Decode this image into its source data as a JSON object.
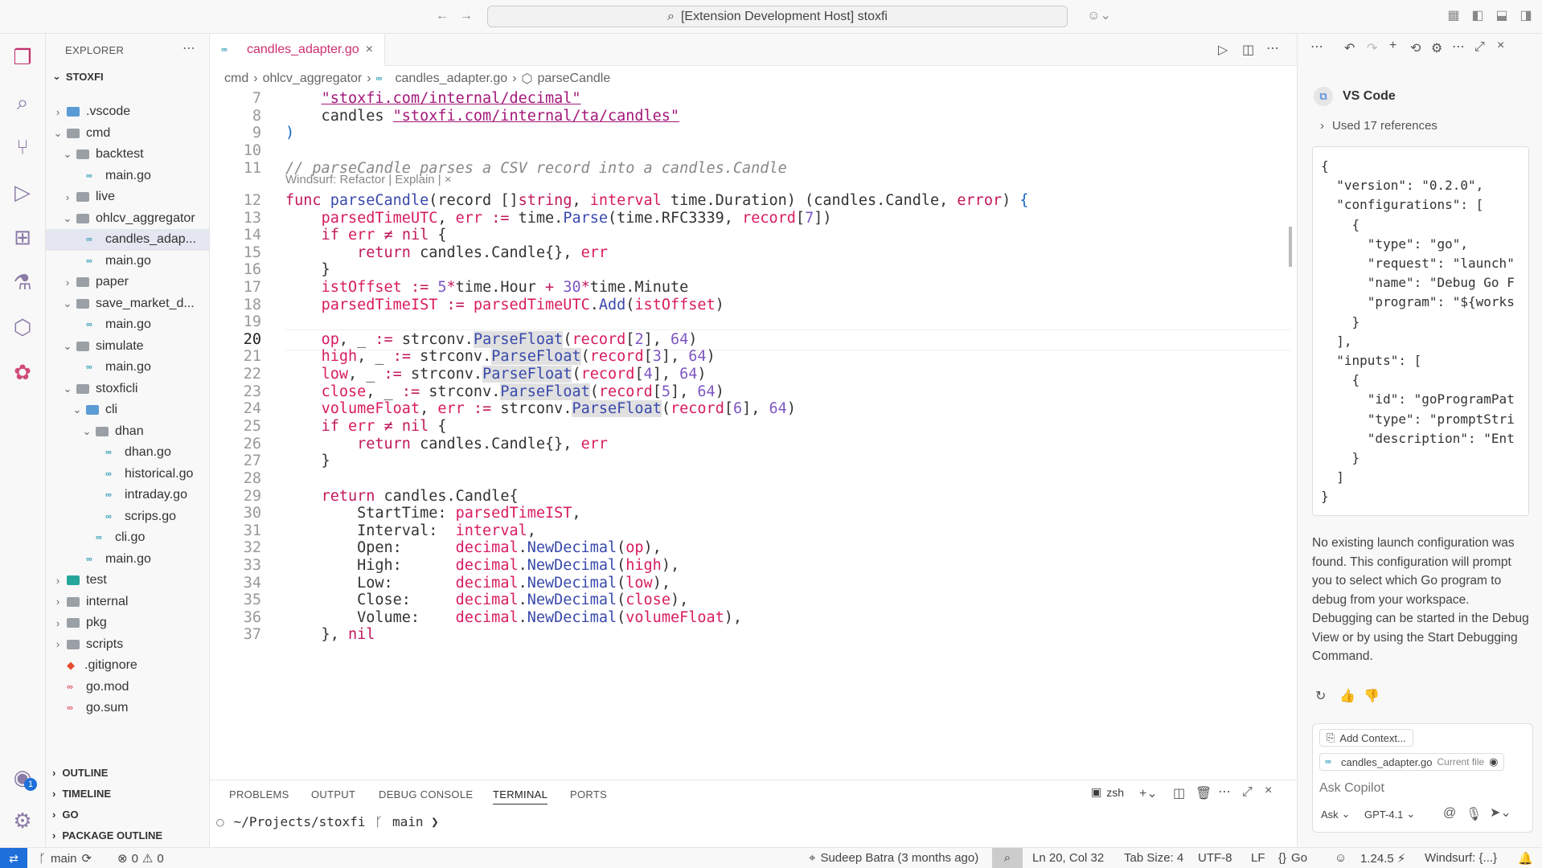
{
  "titlebar": {
    "title": "[Extension Development Host] stoxfi"
  },
  "sidebar": {
    "header": "EXPLORER",
    "root": "STOXFI",
    "items": [
      {
        "label": ".vscode",
        "depth": 1,
        "kind": "folder-blue",
        "chev": "›"
      },
      {
        "label": "cmd",
        "depth": 1,
        "kind": "folder",
        "chev": "⌄"
      },
      {
        "label": "backtest",
        "depth": 2,
        "kind": "folder",
        "chev": "⌄"
      },
      {
        "label": "main.go",
        "depth": 3,
        "kind": "go",
        "chev": ""
      },
      {
        "label": "live",
        "depth": 2,
        "kind": "folder",
        "chev": "›"
      },
      {
        "label": "ohlcv_aggregator",
        "depth": 2,
        "kind": "folder",
        "chev": "⌄"
      },
      {
        "label": "candles_adap...",
        "depth": 3,
        "kind": "go",
        "chev": "",
        "selected": true
      },
      {
        "label": "main.go",
        "depth": 3,
        "kind": "go",
        "chev": ""
      },
      {
        "label": "paper",
        "depth": 2,
        "kind": "folder",
        "chev": "›"
      },
      {
        "label": "save_market_d...",
        "depth": 2,
        "kind": "folder",
        "chev": "⌄"
      },
      {
        "label": "main.go",
        "depth": 3,
        "kind": "go",
        "chev": ""
      },
      {
        "label": "simulate",
        "depth": 2,
        "kind": "folder",
        "chev": "⌄"
      },
      {
        "label": "main.go",
        "depth": 3,
        "kind": "go",
        "chev": ""
      },
      {
        "label": "stoxficli",
        "depth": 2,
        "kind": "folder",
        "chev": "⌄"
      },
      {
        "label": "cli",
        "depth": 3,
        "kind": "folder-blue",
        "chev": "⌄"
      },
      {
        "label": "dhan",
        "depth": 4,
        "kind": "folder",
        "chev": "⌄"
      },
      {
        "label": "dhan.go",
        "depth": 5,
        "kind": "go",
        "chev": ""
      },
      {
        "label": "historical.go",
        "depth": 5,
        "kind": "go",
        "chev": ""
      },
      {
        "label": "intraday.go",
        "depth": 5,
        "kind": "go",
        "chev": ""
      },
      {
        "label": "scrips.go",
        "depth": 5,
        "kind": "go",
        "chev": ""
      },
      {
        "label": "cli.go",
        "depth": 4,
        "kind": "go",
        "chev": ""
      },
      {
        "label": "main.go",
        "depth": 3,
        "kind": "go",
        "chev": ""
      },
      {
        "label": "test",
        "depth": 1,
        "kind": "folder-teal",
        "chev": "›"
      },
      {
        "label": "internal",
        "depth": 1,
        "kind": "folder",
        "chev": "›"
      },
      {
        "label": "pkg",
        "depth": 1,
        "kind": "folder",
        "chev": "›"
      },
      {
        "label": "scripts",
        "depth": 1,
        "kind": "folder",
        "chev": "›"
      },
      {
        "label": ".gitignore",
        "depth": 1,
        "kind": "git",
        "chev": ""
      },
      {
        "label": "go.mod",
        "depth": 1,
        "kind": "mod",
        "chev": ""
      },
      {
        "label": "go.sum",
        "depth": 1,
        "kind": "mod",
        "chev": ""
      }
    ],
    "sections": [
      "OUTLINE",
      "TIMELINE",
      "GO",
      "PACKAGE OUTLINE"
    ]
  },
  "editor": {
    "tab_label": "candles_adapter.go",
    "breadcrumbs": [
      "cmd",
      "ohlcv_aggregator",
      "candles_adapter.go",
      "parseCandle"
    ],
    "codelens": "Windsurf: Refactor | Explain | ×",
    "line_numbers": [
      "7",
      "8",
      "9",
      "10",
      "11",
      "12",
      "13",
      "14",
      "15",
      "16",
      "17",
      "18",
      "19",
      "20",
      "21",
      "22",
      "23",
      "24",
      "25",
      "26",
      "27",
      "28",
      "29",
      "30",
      "31",
      "32",
      "33",
      "34",
      "35",
      "36",
      "37"
    ]
  },
  "panel": {
    "tabs": [
      "PROBLEMS",
      "OUTPUT",
      "DEBUG CONSOLE",
      "TERMINAL",
      "PORTS"
    ],
    "shell": "zsh",
    "prompt_path": "~/Projects/stoxfi",
    "prompt_branch": "main ❯"
  },
  "chat": {
    "agent": "VS Code",
    "refs": "Used 17 references",
    "json": "{\n  \"version\": \"0.2.0\",\n  \"configurations\": [\n    {\n      \"type\": \"go\",\n      \"request\": \"launch\"\n      \"name\": \"Debug Go F\n      \"program\": \"${works\n    }\n  ],\n  \"inputs\": [\n    {\n      \"id\": \"goProgramPat\n      \"type\": \"promptStri\n      \"description\": \"Ent\n    }\n  ]\n}",
    "message": "No existing launch configuration was found. This configuration will prompt you to select which Go program to debug from your workspace. Debugging can be started in the Debug View or by using the Start Debugging Command.",
    "add_context": "Add Context...",
    "file_chip": "candles_adapter.go",
    "file_chip_note": "Current file",
    "placeholder": "Ask Copilot",
    "mode": "Ask",
    "model": "GPT-4.1"
  },
  "status": {
    "branch": "main",
    "problems": "0",
    "warnings": "0",
    "blame": "Sudeep Batra (3 months ago)",
    "position": "Ln 20, Col 32",
    "tabsize": "Tab Size: 4",
    "encoding": "UTF-8",
    "eol": "LF",
    "language": "Go",
    "goversion": "1.24.5",
    "windsurf": "Windsurf: {...}"
  },
  "badges": {
    "accounts": "1"
  }
}
